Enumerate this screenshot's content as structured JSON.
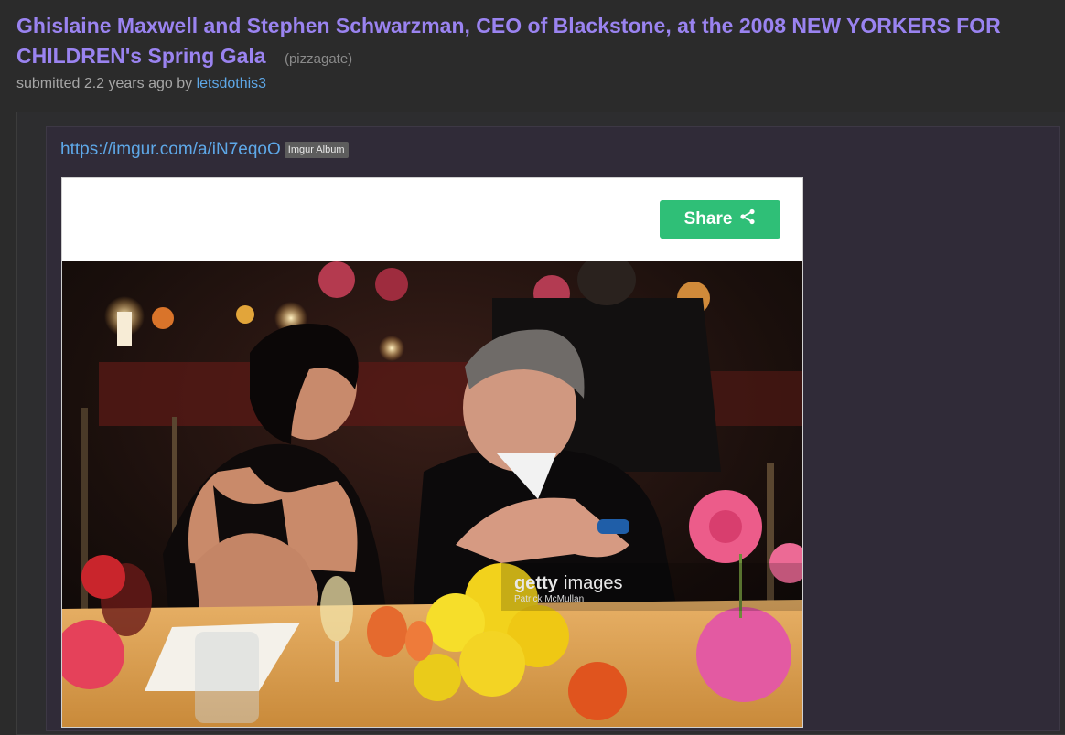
{
  "post": {
    "title": "Ghislaine Maxwell and Stephen Schwarzman, CEO of Blackstone, at the 2008 NEW YORKERS FOR CHILDREN's Spring Gala",
    "domain": "(pizzagate)",
    "submitted_prefix": "submitted 2.2 years ago by",
    "author": "letsdothis3"
  },
  "link": {
    "url": "https://imgur.com/a/iN7eqoO",
    "badge": "Imgur Album"
  },
  "embed": {
    "share_label": "Share",
    "watermark_brand_bold": "getty",
    "watermark_brand_light": "images",
    "watermark_credit": "Patrick McMullan"
  },
  "colors": {
    "title": "#9a83f0",
    "link": "#5ea8e8",
    "share_button": "#2fbf77",
    "background": "#2b2b2b"
  },
  "icons": {
    "share": "share-icon"
  }
}
